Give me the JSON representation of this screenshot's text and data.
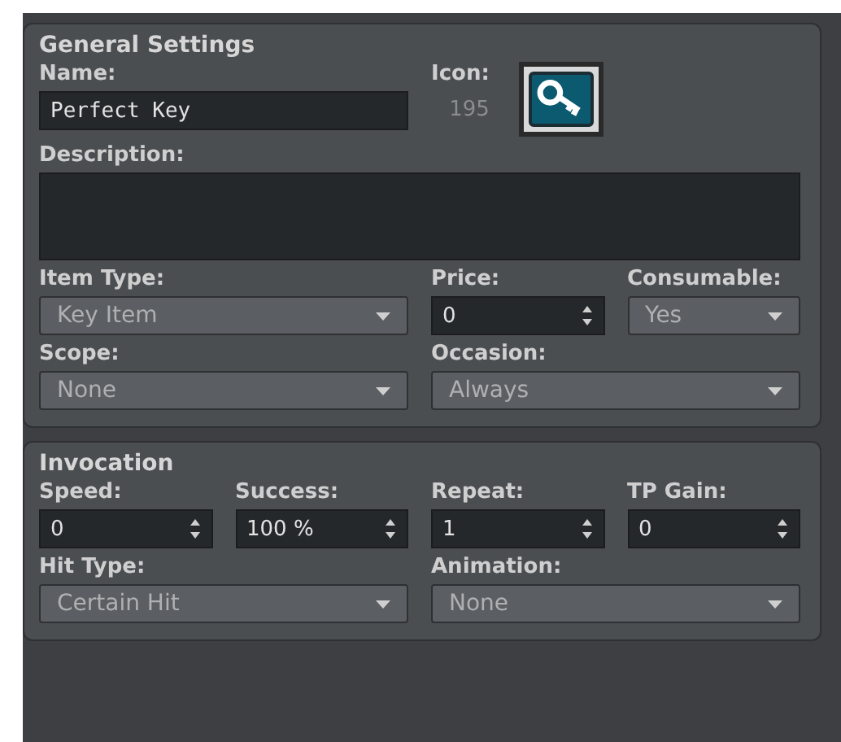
{
  "sections": [
    {
      "title": "General Settings",
      "fields": [
        {
          "kind": "text",
          "label": "Name:",
          "value": "Perfect Key",
          "wide": true
        },
        {
          "kind": "icon",
          "label": "Icon:",
          "value": "195",
          "wide": true
        },
        {
          "kind": "textarea",
          "label": "Description:",
          "wide": true
        },
        {
          "kind": "combo",
          "label": "Item Type:",
          "value": "Key Item",
          "wide": true
        },
        {
          "kind": "spin",
          "label": "Price:",
          "value": "0",
          "wide": false
        },
        {
          "kind": "combo",
          "label": "Consumable:",
          "value": "Yes",
          "wide": false
        },
        {
          "kind": "combo",
          "label": "Scope:",
          "value": "None",
          "wide": true
        },
        {
          "kind": "combo",
          "label": "Occasion:",
          "value": "Always",
          "wide": true
        }
      ]
    },
    {
      "title": "Invocation",
      "fields": [
        {
          "kind": "spin",
          "label": "Speed:",
          "value": "0",
          "wide": false
        },
        {
          "kind": "spin",
          "label": "Success:",
          "value": "100 %",
          "wide": false
        },
        {
          "kind": "spin",
          "label": "Repeat:",
          "value": "1",
          "wide": false
        },
        {
          "kind": "spin",
          "label": "TP Gain:",
          "value": "0",
          "wide": false
        },
        {
          "kind": "combo",
          "label": "Hit Type:",
          "value": "Certain Hit",
          "wide": true
        },
        {
          "kind": "combo",
          "label": "Animation:",
          "value": "None",
          "wide": true
        }
      ]
    }
  ]
}
